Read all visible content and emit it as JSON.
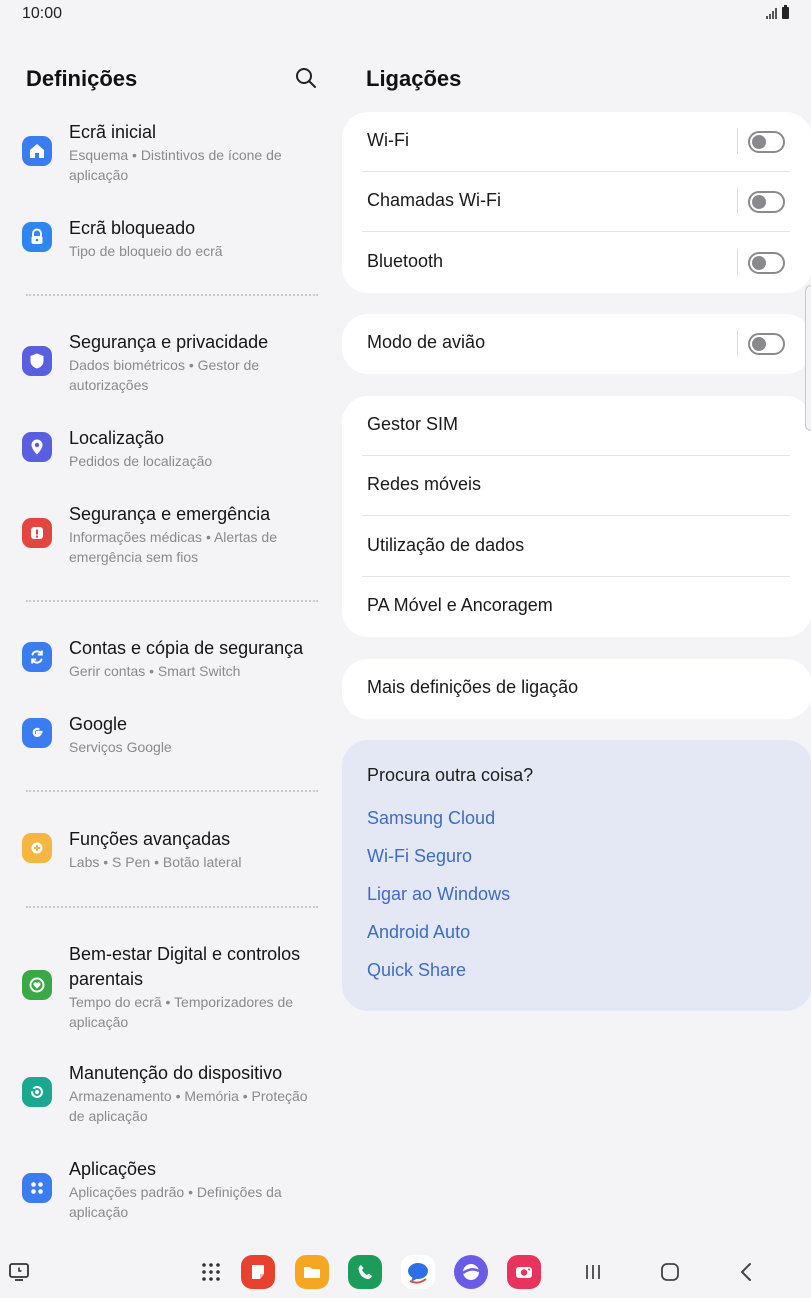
{
  "status": {
    "time": "10:00"
  },
  "left": {
    "title": "Definições",
    "items": [
      {
        "title": "Ecrã inicial",
        "subtitle": "Esquema • Distintivos de ícone de aplicação",
        "icon": "home-icon",
        "color": "#3b7df0"
      },
      {
        "title": "Ecrã bloqueado",
        "subtitle": "Tipo de bloqueio do ecrã",
        "icon": "lock-icon",
        "color": "#2f86ef"
      },
      {
        "title": "Segurança e privacidade",
        "subtitle": "Dados biométricos • Gestor de autorizações",
        "icon": "shield-icon",
        "color": "#5a5fe0"
      },
      {
        "title": "Localização",
        "subtitle": "Pedidos de localização",
        "icon": "location-pin-icon",
        "color": "#5a5fe0"
      },
      {
        "title": "Segurança e emergência",
        "subtitle": "Informações médicas • Alertas de emergência sem fios",
        "icon": "emergency-alert-icon",
        "color": "#e4463f"
      },
      {
        "title": "Contas e cópia de segurança",
        "subtitle": "Gerir contas • Smart Switch",
        "icon": "sync-icon",
        "color": "#3b7df0"
      },
      {
        "title": "Google",
        "subtitle": "Serviços Google",
        "icon": "google-icon",
        "color": "#3b7df0"
      },
      {
        "title": "Funções avançadas",
        "subtitle": "Labs • S Pen • Botão lateral",
        "icon": "gear-plus-icon",
        "color": "#f5b741"
      },
      {
        "title": "Bem-estar Digital e controlos parentais",
        "subtitle": "Tempo do ecrã • Temporizadores de aplicação",
        "icon": "wellbeing-heart-icon",
        "color": "#3ba848"
      },
      {
        "title": "Manutenção do dispositivo",
        "subtitle": "Armazenamento • Memória • Proteção de aplicação",
        "icon": "device-care-icon",
        "color": "#1aa88f"
      },
      {
        "title": "Aplicações",
        "subtitle": "Aplicações padrão • Definições da aplicação",
        "icon": "apps-grid-icon",
        "color": "#3b7df0"
      }
    ]
  },
  "right": {
    "title": "Ligações",
    "card1": [
      {
        "label": "Wi-Fi",
        "toggle": false
      },
      {
        "label": "Chamadas Wi-Fi",
        "toggle": false
      },
      {
        "label": "Bluetooth",
        "toggle": false
      }
    ],
    "card2": [
      {
        "label": "Modo de avião",
        "toggle": false
      }
    ],
    "card3": [
      {
        "label": "Gestor SIM"
      },
      {
        "label": "Redes móveis"
      },
      {
        "label": "Utilização de dados"
      },
      {
        "label": "PA Móvel e Ancoragem"
      }
    ],
    "card4": [
      {
        "label": "Mais definições de ligação"
      }
    ],
    "suggest": {
      "title": "Procura outra coisa?",
      "links": [
        "Samsung Cloud",
        "Wi-Fi Seguro",
        "Ligar ao Windows",
        "Android Auto",
        "Quick Share"
      ]
    }
  },
  "dock": {
    "apps": [
      {
        "name": "notes-app-icon",
        "color": "#e8412f"
      },
      {
        "name": "files-app-icon",
        "color": "#f5a623"
      },
      {
        "name": "phone-app-icon",
        "color": "#1c9c5a"
      },
      {
        "name": "messages-app-icon",
        "color": "#ffffff"
      },
      {
        "name": "browser-app-icon",
        "color": "#6b5ce7"
      },
      {
        "name": "camera-app-icon",
        "color": "#e8335d"
      }
    ]
  }
}
